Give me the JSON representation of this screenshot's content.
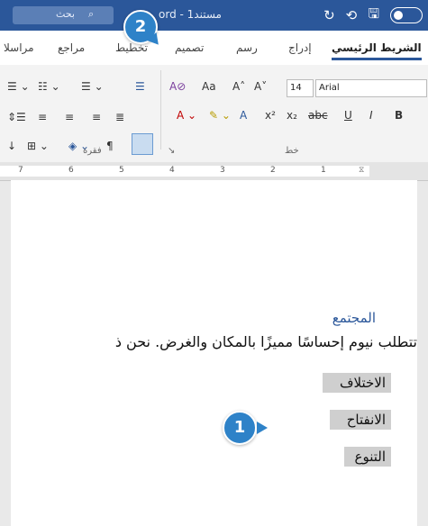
{
  "titlebar": {
    "search_label": "بحث",
    "doc_title": "ord - مستند1",
    "qat": [
      "↻",
      "⟲",
      "🖫"
    ]
  },
  "tabs": [
    "مراسلا",
    "مراجع",
    "تخطيط",
    "تصميم",
    "رسم",
    "إدراج",
    "الشريط الرئيسي"
  ],
  "ribbon": {
    "font_name": "Arial",
    "font_size": "14",
    "font_buttons": [
      "Aa",
      "A˄",
      "A˅"
    ],
    "format_buttons": [
      "B",
      "I",
      "U",
      "abc",
      "x₂",
      "x²"
    ],
    "group_labels": [
      "فقرة",
      "خط"
    ]
  },
  "ruler_marks": [
    "7",
    "6",
    "5",
    "4",
    "3",
    "2",
    "1"
  ],
  "document": {
    "heading": "المجتمع",
    "body": "تتطلب نيوم إحساسًا مميزًا بالمكان والغرض. نحن ذ",
    "list_items": [
      "الاختلاف",
      "الانفتاح",
      "التنوع"
    ]
  },
  "callouts": [
    "1",
    "2"
  ]
}
